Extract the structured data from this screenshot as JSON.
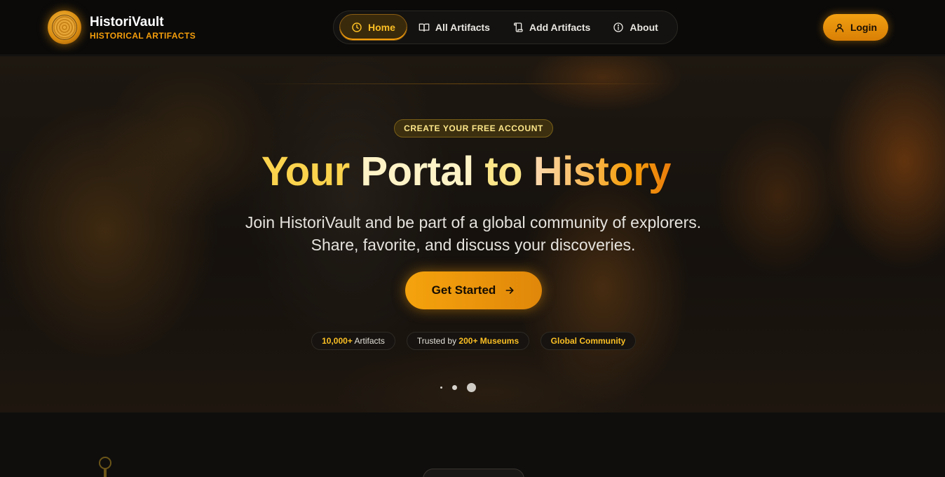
{
  "brand": {
    "name": "HistoriVault",
    "subtitle": "HISTORICAL ARTIFACTS",
    "logo_text": "HISTORICAL ARTIFACTS"
  },
  "nav": {
    "items": [
      {
        "label": "Home",
        "icon": "clock-icon",
        "active": true
      },
      {
        "label": "All Artifacts",
        "icon": "book-icon",
        "active": false
      },
      {
        "label": "Add Artifacts",
        "icon": "scroll-icon",
        "active": false
      },
      {
        "label": "About",
        "icon": "info-icon",
        "active": false
      }
    ],
    "login_label": "Login"
  },
  "hero": {
    "badge": "CREATE YOUR FREE ACCOUNT",
    "title_words": [
      "Your",
      "Portal",
      "to",
      "History"
    ],
    "description": "Join HistoriVault and be part of a global community of explorers. Share, favorite, and discuss your discoveries.",
    "cta_label": "Get Started",
    "stats": [
      {
        "bold": "10,000+",
        "text": " Artifacts"
      },
      {
        "pre": "Trusted by ",
        "bold": "200+ Museums"
      },
      {
        "bold": "Global Community"
      }
    ],
    "carousel": {
      "slides": 3,
      "active": 3
    }
  },
  "colors": {
    "accent": "#f59e0b",
    "accent_light": "#fbbf24",
    "background": "#0b0a09"
  }
}
